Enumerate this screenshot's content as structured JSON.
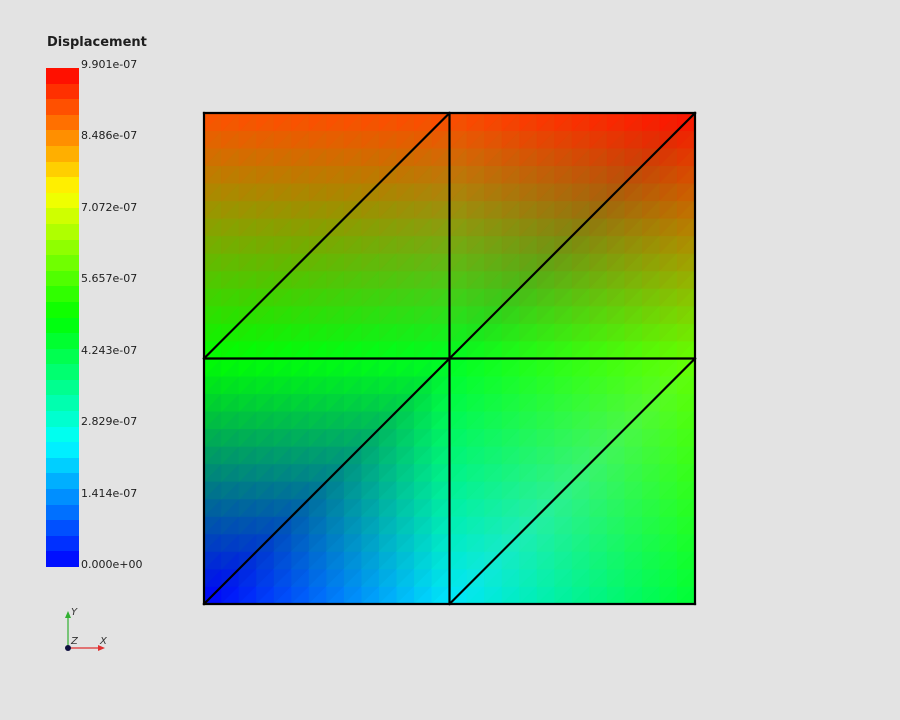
{
  "scalar_bar": {
    "title": "Displacement",
    "labels": [
      "9.901e-07",
      "8.486e-07",
      "7.072e-07",
      "5.657e-07",
      "4.243e-07",
      "2.829e-07",
      "1.414e-07",
      "0.000e+00"
    ],
    "num_colors": 32,
    "range": [
      0.0,
      9.901e-07
    ]
  },
  "mesh": {
    "grid": "2x2 quads, each split by a diagonal from bottom-left to top-right",
    "edge_color": "#000000",
    "nodes": [
      {
        "id": "n00",
        "col": 0,
        "row": 0,
        "color": "#0000ff"
      },
      {
        "id": "n10",
        "col": 1,
        "row": 0,
        "color": "#00e5ff"
      },
      {
        "id": "n20",
        "col": 2,
        "row": 0,
        "color": "#00ff33"
      },
      {
        "id": "n01",
        "col": 0,
        "row": 1,
        "color": "#00ff00"
      },
      {
        "id": "n11",
        "col": 1,
        "row": 1,
        "color": "#00ff20"
      },
      {
        "id": "n21",
        "col": 2,
        "row": 1,
        "color": "#66ff00"
      },
      {
        "id": "n02",
        "col": 0,
        "row": 2,
        "color": "#ff5000"
      },
      {
        "id": "n12",
        "col": 1,
        "row": 2,
        "color": "#ff4a00"
      },
      {
        "id": "n22",
        "col": 2,
        "row": 2,
        "color": "#ff1000"
      }
    ]
  },
  "axes": {
    "x_label": "X",
    "y_label": "Y",
    "z_label": "Z",
    "x_color": "#e03030",
    "y_color": "#30b030",
    "z_color": "#101040"
  }
}
